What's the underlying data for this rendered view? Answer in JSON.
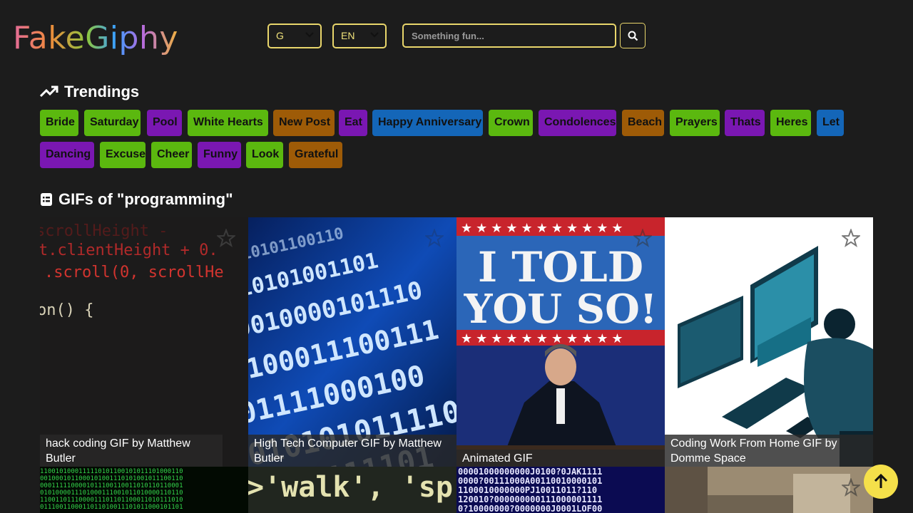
{
  "app": {
    "logo": "FakeGiphy"
  },
  "header": {
    "rating_select": "G",
    "language_select": "EN",
    "search_placeholder": "Something fun...",
    "search_icon": "magnifier-icon"
  },
  "trendings": {
    "title": "Trendings",
    "icon": "trending-up-icon",
    "tags": [
      {
        "label": "Bride",
        "color": "green"
      },
      {
        "label": "Saturday",
        "color": "green"
      },
      {
        "label": "Pool",
        "color": "purple"
      },
      {
        "label": "White Hearts",
        "color": "green"
      },
      {
        "label": "New Post",
        "color": "brown"
      },
      {
        "label": "Eat",
        "color": "purple"
      },
      {
        "label": "Happy Anniversary",
        "color": "blue"
      },
      {
        "label": "Crown",
        "color": "green"
      },
      {
        "label": "Condolences",
        "color": "purple"
      },
      {
        "label": "Beach",
        "color": "brown"
      },
      {
        "label": "Prayers",
        "color": "green"
      },
      {
        "label": "Thats",
        "color": "purple"
      },
      {
        "label": "Heres",
        "color": "green"
      },
      {
        "label": "Let",
        "color": "blue"
      },
      {
        "label": "Dancing",
        "color": "purple"
      },
      {
        "label": "Excuse",
        "color": "green"
      },
      {
        "label": "Cheer",
        "color": "green"
      },
      {
        "label": "Funny",
        "color": "purple"
      },
      {
        "label": "Look",
        "color": "green"
      },
      {
        "label": "Grateful",
        "color": "brown"
      }
    ],
    "colors": {
      "green": "#5bb80f",
      "purple": "#7a17b2",
      "brown": "#9e5b07",
      "blue": "#1466b8"
    }
  },
  "gifs": {
    "title": "GIFs of \"programming\"",
    "icon": "document-list-icon",
    "items": [
      {
        "caption": "hack coding GIF by Matthew Butler",
        "favorite_icon": "star-outline-icon"
      },
      {
        "caption": "High Tech Computer GIF by Matthew Butler",
        "favorite_icon": "star-outline-icon"
      },
      {
        "caption": "Animated GIF",
        "favorite_icon": "star-outline-icon"
      },
      {
        "caption": "Coding Work From Home GIF by Domme Space",
        "favorite_icon": "star-outline-icon"
      }
    ],
    "gif_texts": {
      "code_line_1": "t.clientHeight + 0.",
      "code_line_2": ".scroll(0, scrollHe",
      "code_line_3": "on() {",
      "told_line_1": "I TOLD",
      "told_line_2": "YOU SO!",
      "walk_text": ">'walk', 'sp"
    }
  },
  "scroll_top": {
    "icon": "arrow-up-icon"
  }
}
